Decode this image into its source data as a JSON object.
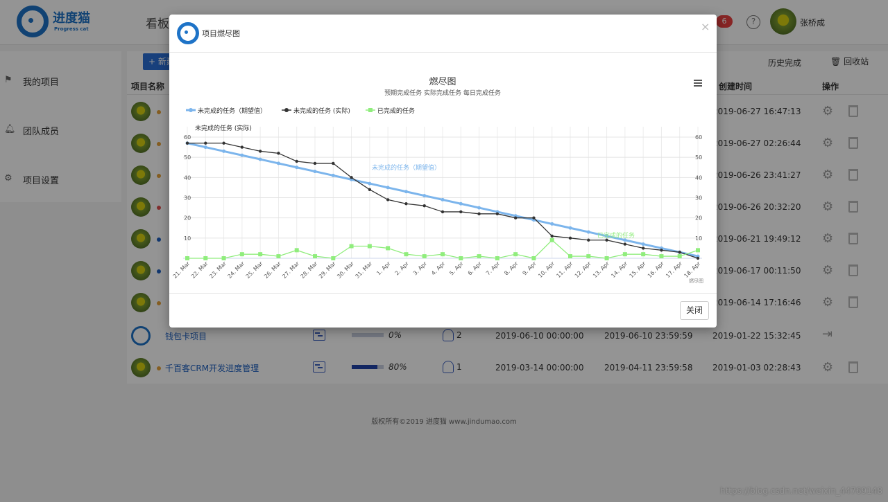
{
  "app": {
    "logo_text": "进度猫",
    "logo_sub": "Progress cat",
    "nav_board": "看板",
    "notification_count": "6",
    "help_symbol": "?",
    "user_name": "张桥成",
    "new_button": "+ 新建",
    "tab_history": "历史完成",
    "tab_recycle": "回收站"
  },
  "sidebar": {
    "items": [
      {
        "label": "我的项目",
        "icon": "flag-icon"
      },
      {
        "label": "团队成员",
        "icon": "bell-icon"
      },
      {
        "label": "项目设置",
        "icon": "gear-icon"
      }
    ]
  },
  "table": {
    "headers": {
      "name": "项目名称",
      "created": "创建时间",
      "ops": "操作"
    },
    "rows": [
      {
        "created": "2019-06-27 16:47:13",
        "dot_color": "#e6a23c"
      },
      {
        "created": "2019-06-27 02:26:44",
        "dot_color": "#e6a23c"
      },
      {
        "created": "2019-06-26 23:41:27",
        "dot_color": "#e6a23c"
      },
      {
        "created": "2019-06-26 20:32:20",
        "dot_color": "#e05050"
      },
      {
        "created": "2019-06-21 19:49:12",
        "dot_color": "#1e60c0"
      },
      {
        "created": "2019-06-17 00:11:50",
        "dot_color": "#1e60c0"
      },
      {
        "created": "2019-06-14 17:16:46",
        "dot_color": "#e6a23c"
      },
      {
        "name": "钱包卡项目",
        "progress_label": "0%",
        "progress": 0,
        "members": "2",
        "start": "2019-06-10 00:00:00",
        "end": "2019-06-10 23:59:59",
        "created": "2019-01-22 15:32:45"
      },
      {
        "name": "千百客CRM开发进度管理",
        "progress_label": "80%",
        "progress": 0.8,
        "members": "1",
        "start": "2019-03-14 00:00:00",
        "end": "2019-04-11 23:59:58",
        "created": "2019-01-03 02:28:43",
        "dot_color": "#e6a23c"
      }
    ]
  },
  "footer": "版权所有©2019 进度猫 www.jindumao.com",
  "watermark": "https://blog.csdn.net/weixin_44769148",
  "modal": {
    "title": "项目燃尽图",
    "close_symbol": "×",
    "close_button": "关闭"
  },
  "chart_data": {
    "type": "line",
    "title": "燃尽图",
    "subtitle": "预期完成任务 实际完成任务 每日完成任务",
    "credits": "燃尽图",
    "menu_icon": "hamburger-menu-icon",
    "categories": [
      "21. Mar",
      "22. Mar",
      "23. Mar",
      "24. Mar",
      "25. Mar",
      "26. Mar",
      "27. Mar",
      "28. Mar",
      "29. Mar",
      "30. Mar",
      "31. Mar",
      "1. Apr",
      "2. Apr",
      "3. Apr",
      "4. Apr",
      "5. Apr",
      "6. Apr",
      "7. Apr",
      "8. Apr",
      "9. Apr",
      "10. Apr",
      "11. Apr",
      "12. Apr",
      "13. Apr",
      "14. Apr",
      "15. Apr",
      "16. Apr",
      "17. Apr",
      "18. Apr"
    ],
    "ylim": [
      0,
      60
    ],
    "yticks": [
      10,
      20,
      30,
      40,
      50,
      60
    ],
    "grid": true,
    "legend_position": "top-left",
    "series": [
      {
        "name": "未完成的任务（期望值）",
        "color": "#7cb5ec",
        "marker": "circle",
        "label": "未完成的任务（期望值）",
        "values": [
          57,
          55,
          53,
          51,
          49,
          47,
          45,
          43,
          41,
          39,
          37,
          35,
          33,
          31,
          29,
          27,
          25,
          23,
          21,
          19,
          17,
          15,
          13,
          11,
          9,
          7,
          5,
          3,
          1
        ]
      },
      {
        "name": "未完成的任务 (实际)",
        "color": "#333333",
        "marker": "diamond",
        "label": "未完成的任务 (实际)",
        "values": [
          57,
          57,
          57,
          55,
          53,
          52,
          48,
          47,
          47,
          40,
          34,
          29,
          27,
          26,
          23,
          23,
          22,
          22,
          20,
          20,
          11,
          10,
          9,
          9,
          7,
          5,
          4,
          3,
          0
        ]
      },
      {
        "name": "已完成的任务",
        "color": "#90ed7d",
        "marker": "square",
        "label": "已完成的任务",
        "values": [
          0,
          0,
          0,
          2,
          2,
          1,
          4,
          1,
          0,
          6,
          6,
          5,
          2,
          1,
          2,
          0,
          1,
          0,
          2,
          0,
          9,
          1,
          1,
          0,
          2,
          2,
          1,
          1,
          4
        ]
      }
    ]
  }
}
